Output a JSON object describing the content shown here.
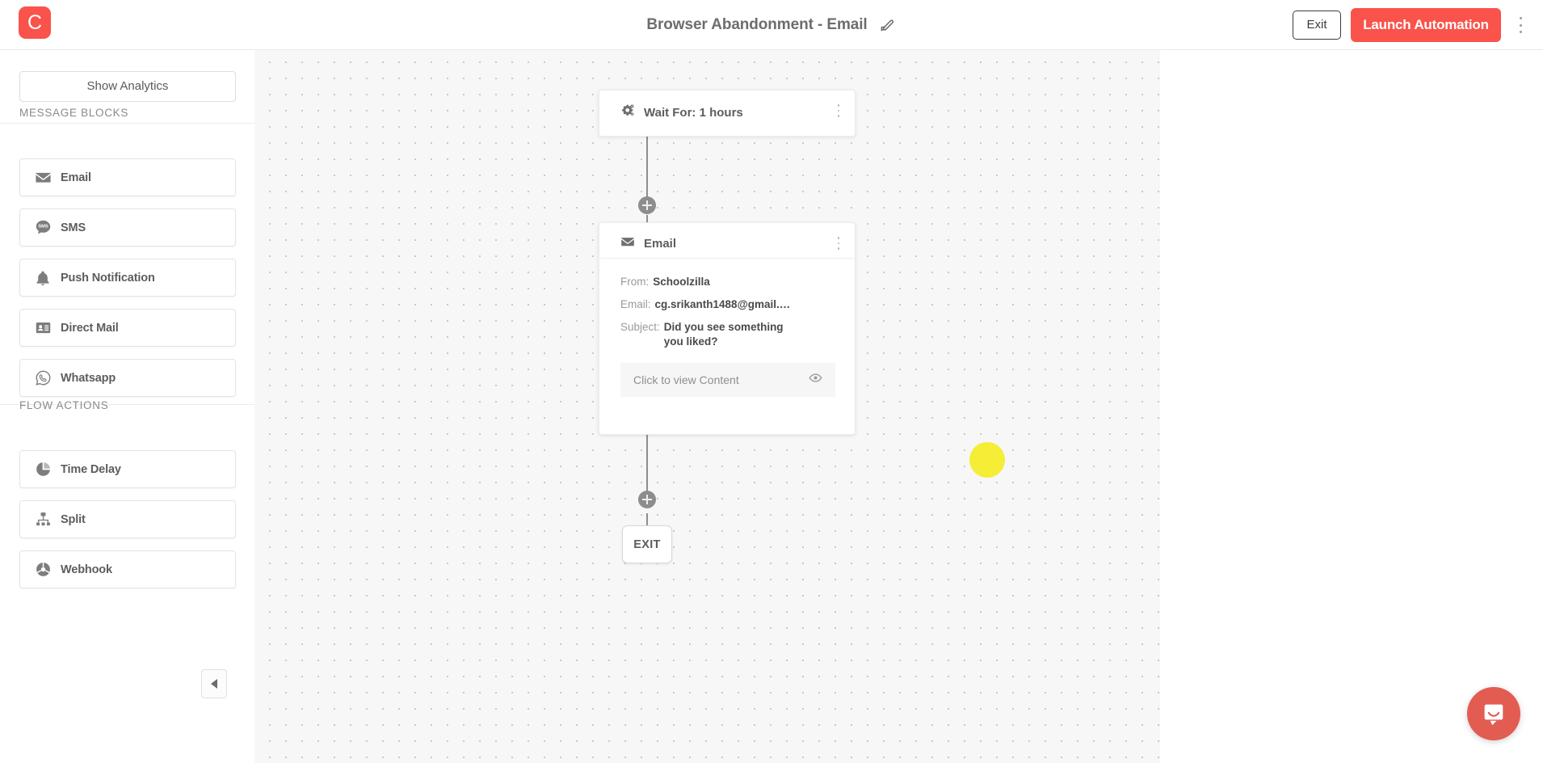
{
  "header": {
    "logo_letter": "C",
    "logo_color": "#f9534b",
    "title": "Browser Abandonment - Email",
    "edit_icon": "edit-pencil-icon",
    "exit_label": "Exit",
    "launch_label": "Launch Automation",
    "launch_color": "#f9534b",
    "overflow_icon": "vertical-dots-icon"
  },
  "sidebar": {
    "show_analytics_label": "Show Analytics",
    "message_blocks_heading": "MESSAGE BLOCKS",
    "message_blocks": [
      {
        "label": "Email",
        "icon": "envelope-icon"
      },
      {
        "label": "SMS",
        "icon": "sms-bubble-icon"
      },
      {
        "label": "Push Notification",
        "icon": "bell-icon"
      },
      {
        "label": "Direct Mail",
        "icon": "contact-card-icon"
      },
      {
        "label": "Whatsapp",
        "icon": "whatsapp-icon"
      }
    ],
    "flow_actions_heading": "FLOW ACTIONS",
    "flow_actions": [
      {
        "label": "Time Delay",
        "icon": "pie-clock-icon"
      },
      {
        "label": "Split",
        "icon": "split-hierarchy-icon"
      },
      {
        "label": "Webhook",
        "icon": "webhook-globe-icon"
      }
    ],
    "collapse_icon": "chevron-left-icon"
  },
  "canvas": {
    "wait_node": {
      "icon": "gears-icon",
      "label_prefix": "Wait For: ",
      "duration": "1 hours",
      "full_label": "Wait For: 1 hours",
      "kebab_icon": "vertical-dots-icon"
    },
    "email_node": {
      "icon": "envelope-icon",
      "title": "Email",
      "kebab_icon": "vertical-dots-icon",
      "from_key": "From:",
      "from_value": "Schoolzilla",
      "email_key": "Email:",
      "email_value": "cg.srikanth1488@gmail.…",
      "subject_key": "Subject:",
      "subject_value": "Did you see something you liked?",
      "view_content_label": "Click to view Content",
      "view_content_icon": "eye-icon"
    },
    "exit_node_label": "EXIT",
    "add_node_icon": "plus-circle-icon",
    "click_marker_color": "#f5ed36"
  },
  "intercom": {
    "icon": "chat-bubble-icon",
    "color": "#e25c52"
  }
}
